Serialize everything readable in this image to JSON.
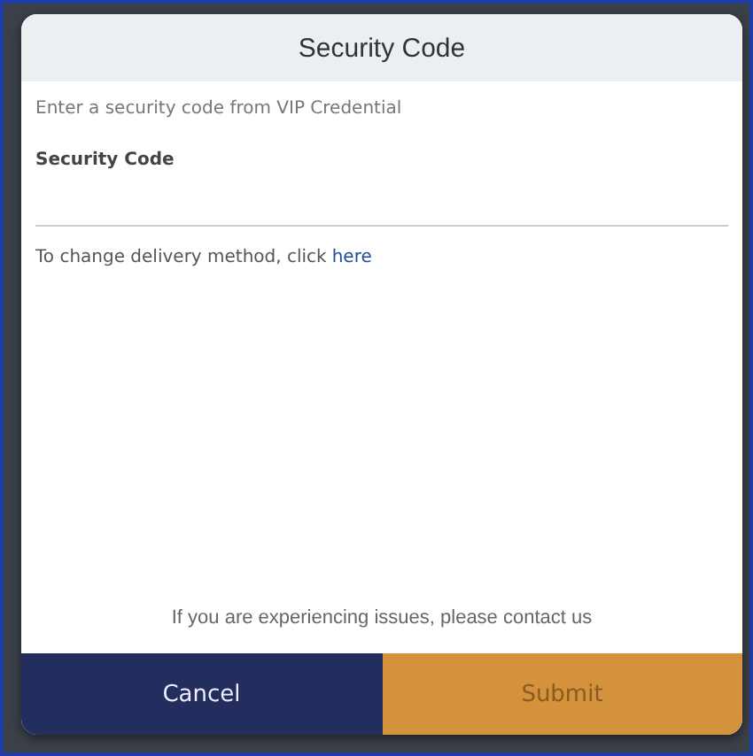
{
  "dialog": {
    "title": "Security Code",
    "instruction": "Enter a security code from VIP Credential",
    "field": {
      "label": "Security Code"
    },
    "delivery": {
      "text": "To change delivery method, click",
      "link": "here"
    },
    "help": "If you are experiencing issues, please contact us",
    "buttons": [
      {
        "label": "Cancel",
        "kind": "secondary"
      },
      {
        "label": "Submit",
        "kind": "primary"
      }
    ]
  }
}
